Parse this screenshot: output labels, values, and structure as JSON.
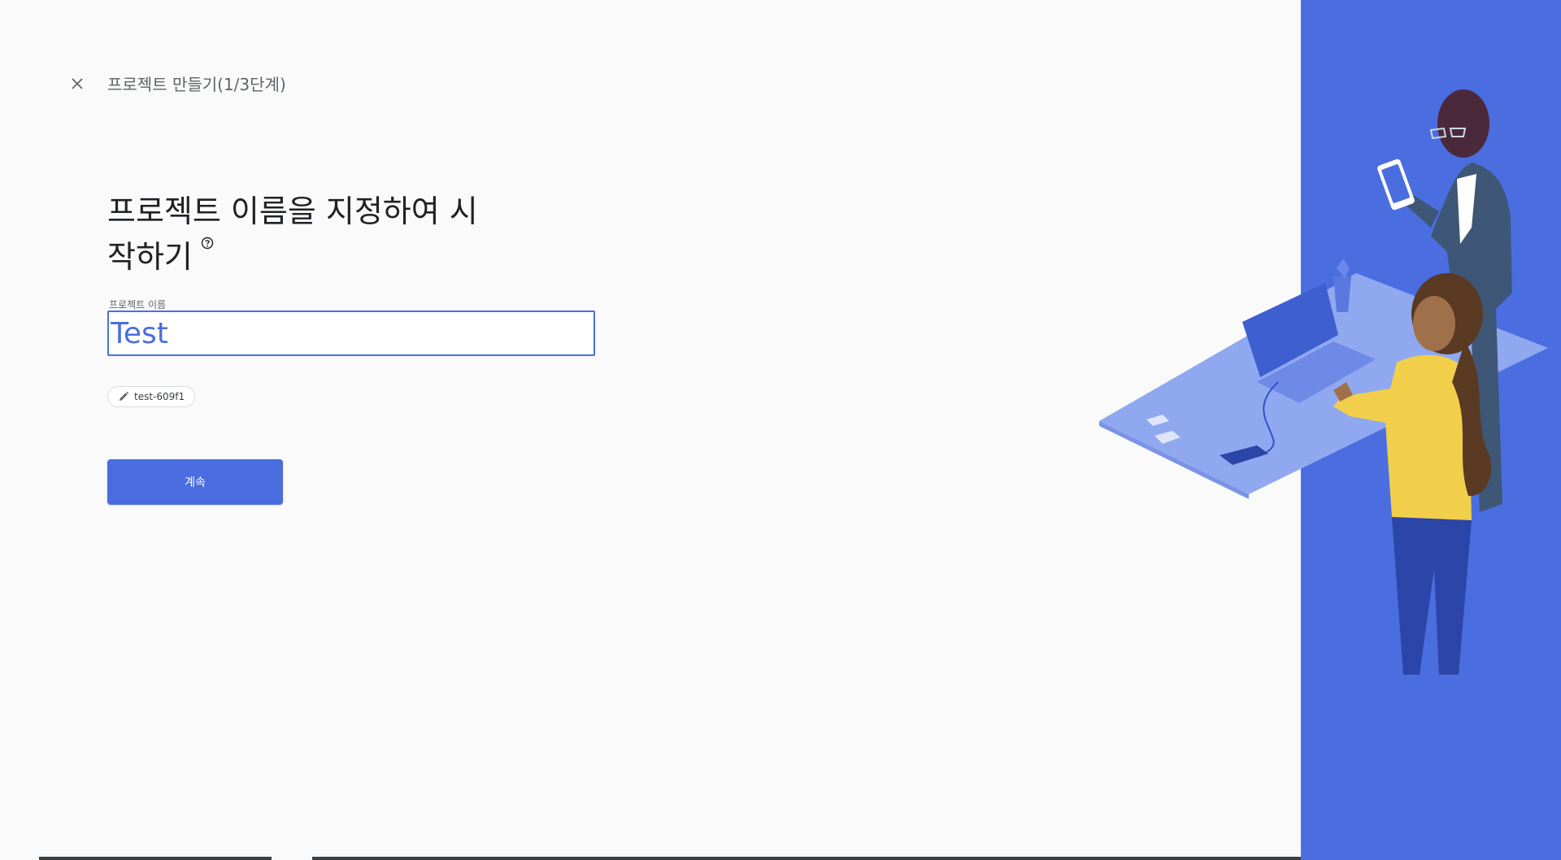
{
  "header": {
    "close_icon": "close-icon",
    "step_title": "프로젝트 만들기(1/3단계)"
  },
  "main": {
    "heading_line1": "프로젝트 이름을 지정하여 시",
    "heading_line2": "작하기",
    "help_icon": "help-circle-icon",
    "field_label": "프로젝트 이름",
    "field_value": "Test",
    "project_id": "test-609f1",
    "project_id_icon": "pencil-icon",
    "continue_label": "계속"
  },
  "colors": {
    "accent": "#4a6ee0",
    "illustration_bg": "#4a6ee0",
    "background": "#fafafa"
  }
}
